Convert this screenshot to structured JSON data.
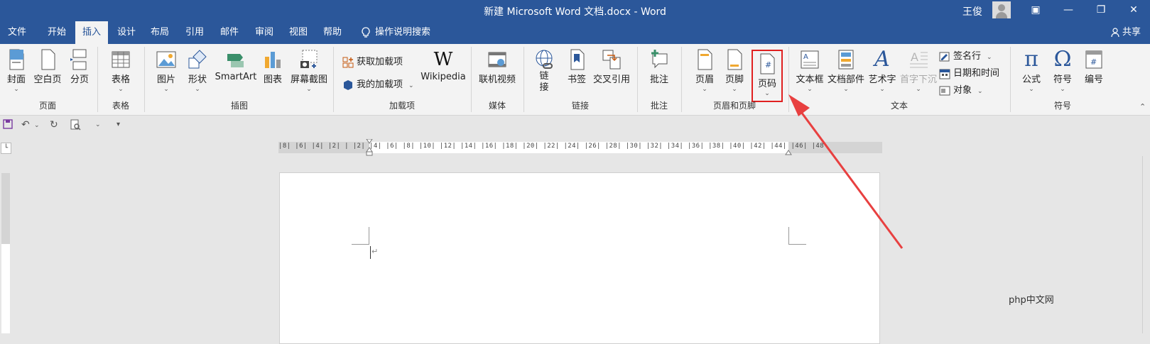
{
  "titlebar": {
    "title": "新建 Microsoft Word 文档.docx  -  Word",
    "user": "王俊",
    "min_icon": "—",
    "restore_icon": "❐",
    "close_icon": "✕",
    "ribbon_display_icon": "▣"
  },
  "tabs": [
    "文件",
    "开始",
    "插入",
    "设计",
    "布局",
    "引用",
    "邮件",
    "审阅",
    "视图",
    "帮助"
  ],
  "active_tab": "插入",
  "tell_me": "操作说明搜索",
  "share": "共享",
  "groups": {
    "pages": {
      "label": "页面",
      "cover": "封面",
      "blank": "空白页",
      "break": "分页"
    },
    "tables": {
      "label": "表格",
      "table": "表格"
    },
    "illustrations": {
      "label": "插图",
      "pictures": "图片",
      "shapes": "形状",
      "smartart": "SmartArt",
      "chart": "图表",
      "screenshot": "屏幕截图"
    },
    "addins": {
      "label": "加载项",
      "get": "获取加载项",
      "my": "我的加载项",
      "wikipedia": "Wikipedia"
    },
    "media": {
      "label": "媒体",
      "video": "联机视频"
    },
    "links": {
      "label": "链接",
      "link": "链接",
      "bookmark": "书签",
      "crossref": "交叉引用"
    },
    "comments": {
      "label": "批注",
      "comment": "批注"
    },
    "headerfooter": {
      "label": "页眉和页脚",
      "header": "页眉",
      "footer": "页脚",
      "pagenum": "页码"
    },
    "text": {
      "label": "文本",
      "textbox": "文本框",
      "quickparts": "文档部件",
      "wordart": "艺术字",
      "dropcap": "首字下沉",
      "signature": "签名行",
      "datetime": "日期和时间",
      "object": "对象"
    },
    "symbols": {
      "label": "符号",
      "equation": "公式",
      "symbol": "符号",
      "number": "编号"
    }
  },
  "ruler_text": "|8|  |6|  |4|  |2|  |  |2|  |4|  |6|  |8|  |10| |12| |14| |16| |18| |20| |22| |24| |26| |28| |30| |32| |34| |36| |38| |40| |42| |44| |46| |48",
  "watermark": "php中文网",
  "colors": {
    "accent": "#2b579a",
    "highlight": "#e02020",
    "arrow": "#e84040"
  }
}
